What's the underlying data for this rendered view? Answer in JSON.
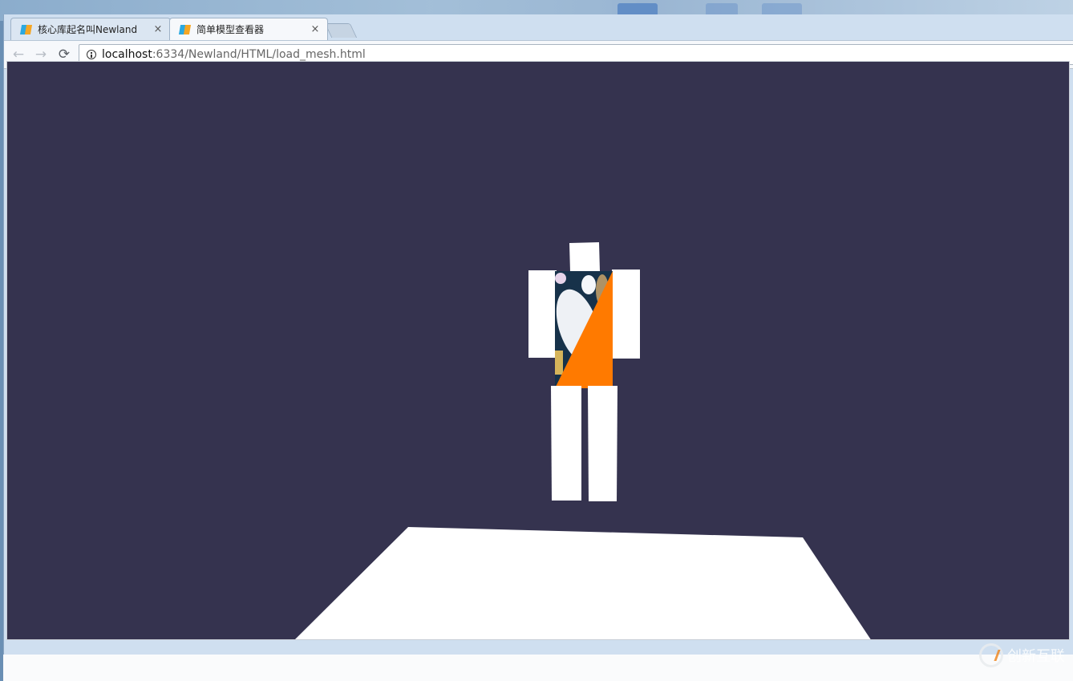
{
  "browser": {
    "tabs": [
      {
        "label": "核心库起名叫Newland",
        "close": "×",
        "active": false
      },
      {
        "label": "简单模型查看器",
        "close": "×",
        "active": true
      }
    ],
    "nav": {
      "back": "←",
      "forward": "→",
      "reload": "⟳"
    },
    "address": {
      "host": "localhost",
      "rest": ":6334/Newland/HTML/load_mesh.html"
    }
  },
  "scene": {
    "background_color": "#35334f",
    "model_color": "#ffffff",
    "accent_color": "#ff7a00",
    "objects": [
      "head",
      "left-arm",
      "right-arm",
      "torso",
      "left-leg",
      "right-leg",
      "floor-plane"
    ]
  },
  "watermark": {
    "text": "创新互联"
  }
}
